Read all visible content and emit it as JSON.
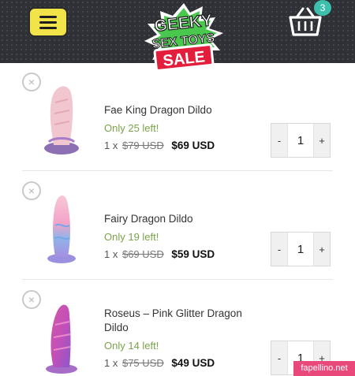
{
  "header": {
    "logo_line1": "GEEKY",
    "logo_line2": "SEX TOYS",
    "logo_line3": "SALE",
    "cart_count": "3"
  },
  "items": [
    {
      "name": "Fae King Dragon Dildo",
      "stock": "Only 25 left!",
      "qty_prefix": "1 x",
      "old_price": "$79 USD",
      "new_price": "$69 USD",
      "quantity": "1",
      "minus": "-",
      "plus": "+",
      "remove": "×"
    },
    {
      "name": "Fairy Dragon Dildo",
      "stock": "Only 19 left!",
      "qty_prefix": "1 x",
      "old_price": "$69 USD",
      "new_price": "$59 USD",
      "quantity": "1",
      "minus": "-",
      "plus": "+",
      "remove": "×"
    },
    {
      "name": "Roseus – Pink Glitter Dragon Dildo",
      "stock": "Only 14 left!",
      "qty_prefix": "1 x",
      "old_price": "$75 USD",
      "new_price": "$49 USD",
      "quantity": "1",
      "minus": "-",
      "plus": "+",
      "remove": "×"
    }
  ],
  "watermark": "fapellino.net",
  "colors": {
    "header_bg": "#2f3136",
    "menu_button": "#f2e34a",
    "badge": "#3cc0ad",
    "stock_text": "#7aa34a",
    "watermark_bg": "#e8497a"
  }
}
